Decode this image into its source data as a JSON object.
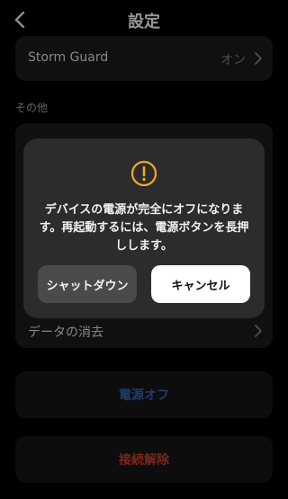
{
  "header": {
    "title": "設定"
  },
  "storm_guard": {
    "label": "Storm Guard",
    "value": "オン"
  },
  "section_other": {
    "title": "その他"
  },
  "data_erase": {
    "label": "データの消去"
  },
  "power_off": {
    "label": "電源オフ"
  },
  "disconnect": {
    "label": "接続解除"
  },
  "dialog": {
    "message": "デバイスの電源が完全にオフになります。再起動するには、電源ボタンを長押しします。",
    "shutdown_label": "シャットダウン",
    "cancel_label": "キャンセル"
  },
  "colors": {
    "background": "#000000",
    "card": "#1a1a1a",
    "modal": "#2c2c2e",
    "warning": "#f5a623",
    "power_off_text": "#2f5fa8",
    "disconnect_text": "#c03a2b"
  },
  "icons": [
    "chevron-left-icon",
    "chevron-right-icon",
    "warning-icon"
  ]
}
